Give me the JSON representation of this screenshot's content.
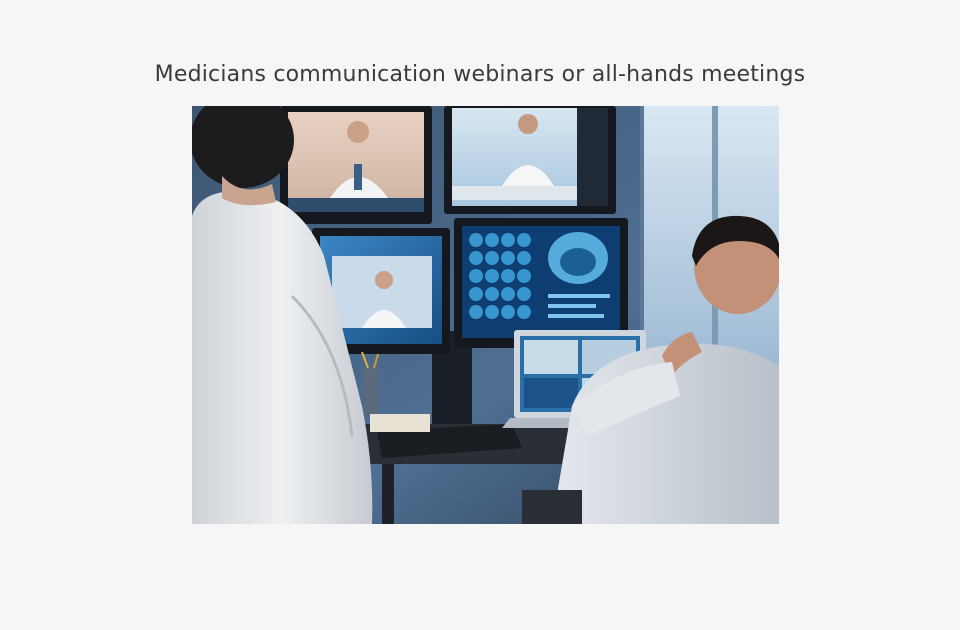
{
  "caption": "Medicians communication webinars or all-hands meetings",
  "photo": {
    "alt": "Two doctors in white coats watching a wall of monitors showing video calls with other doctors and brain scans",
    "colors": {
      "room": "#4f6f92",
      "window": "#b9d3e8",
      "screen_blue": "#2a6ea8",
      "coat": "#e7eaee",
      "desk": "#2a2f36"
    }
  }
}
